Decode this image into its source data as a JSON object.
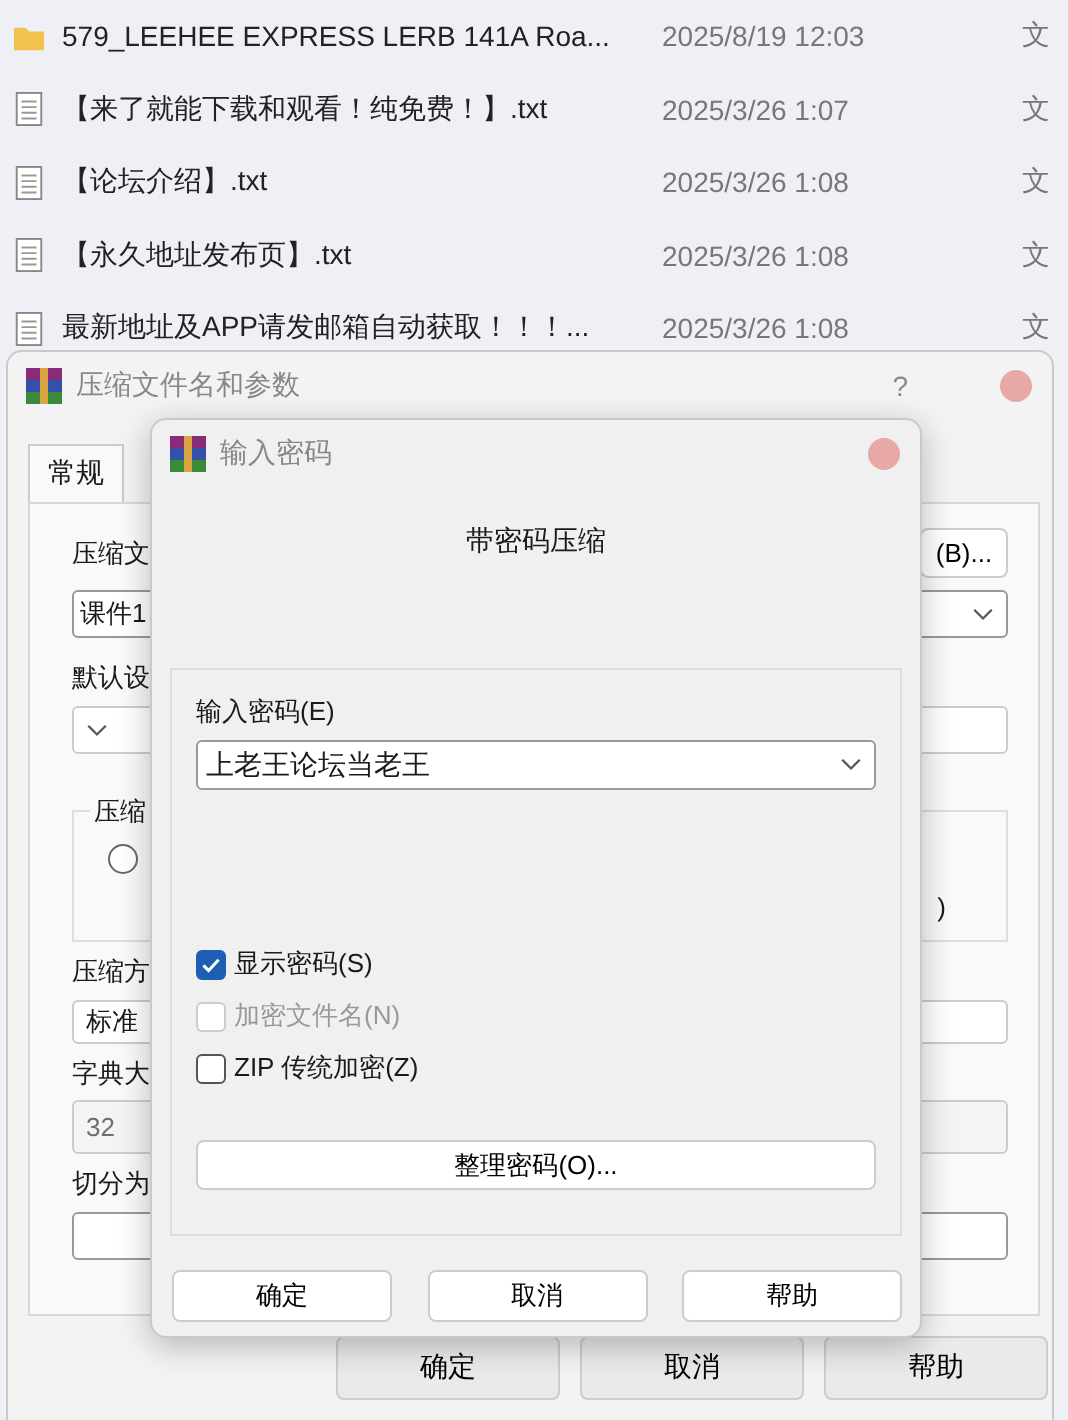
{
  "file_list": {
    "rows": [
      {
        "kind": "folder",
        "name": "579_LEEHEE EXPRESS LERB 141A Roa...",
        "modified": "2025/8/19 12:03",
        "type": "文"
      },
      {
        "kind": "text",
        "name": "【来了就能下载和观看！纯免费！】.txt",
        "modified": "2025/3/26 1:07",
        "type": "文"
      },
      {
        "kind": "text",
        "name": "【论坛介绍】.txt",
        "modified": "2025/3/26 1:08",
        "type": "文"
      },
      {
        "kind": "text",
        "name": "【永久地址发布页】.txt",
        "modified": "2025/3/26 1:08",
        "type": "文"
      },
      {
        "kind": "text",
        "name": "最新地址及APP请发邮箱自动获取！！！...",
        "modified": "2025/3/26 1:08",
        "type": "文"
      }
    ]
  },
  "archive_dialog": {
    "title": "压缩文件名和参数",
    "help": "?",
    "tabs": [
      {
        "label": "常规",
        "selected": true
      }
    ],
    "archive_name": {
      "label": "压缩文",
      "value": "课件1"
    },
    "browse_button": "(B)...",
    "profile": {
      "label": "默认设"
    },
    "format_group": {
      "label": "压缩",
      "options": [
        {
          "selected": false
        }
      ]
    },
    "fragment": ")",
    "method": {
      "label": "压缩方",
      "value": "标准"
    },
    "dictionary": {
      "label": "字典大",
      "value": "32",
      "disabled": true
    },
    "split": {
      "label": "切分为"
    },
    "buttons": [
      "确定",
      "取消",
      "帮助"
    ]
  },
  "password_dialog": {
    "title": "输入密码",
    "heading": "带密码压缩",
    "password": {
      "label": "输入密码(E)",
      "value": "上老王论坛当老王"
    },
    "options": [
      {
        "label": "显示密码(S)",
        "checked": true,
        "disabled": false
      },
      {
        "label": "加密文件名(N)",
        "checked": false,
        "disabled": true
      },
      {
        "label": "ZIP 传统加密(Z)",
        "checked": false,
        "disabled": false
      }
    ],
    "organize_button": "整理密码(O)...",
    "buttons": [
      "确定",
      "取消",
      "帮助"
    ]
  }
}
